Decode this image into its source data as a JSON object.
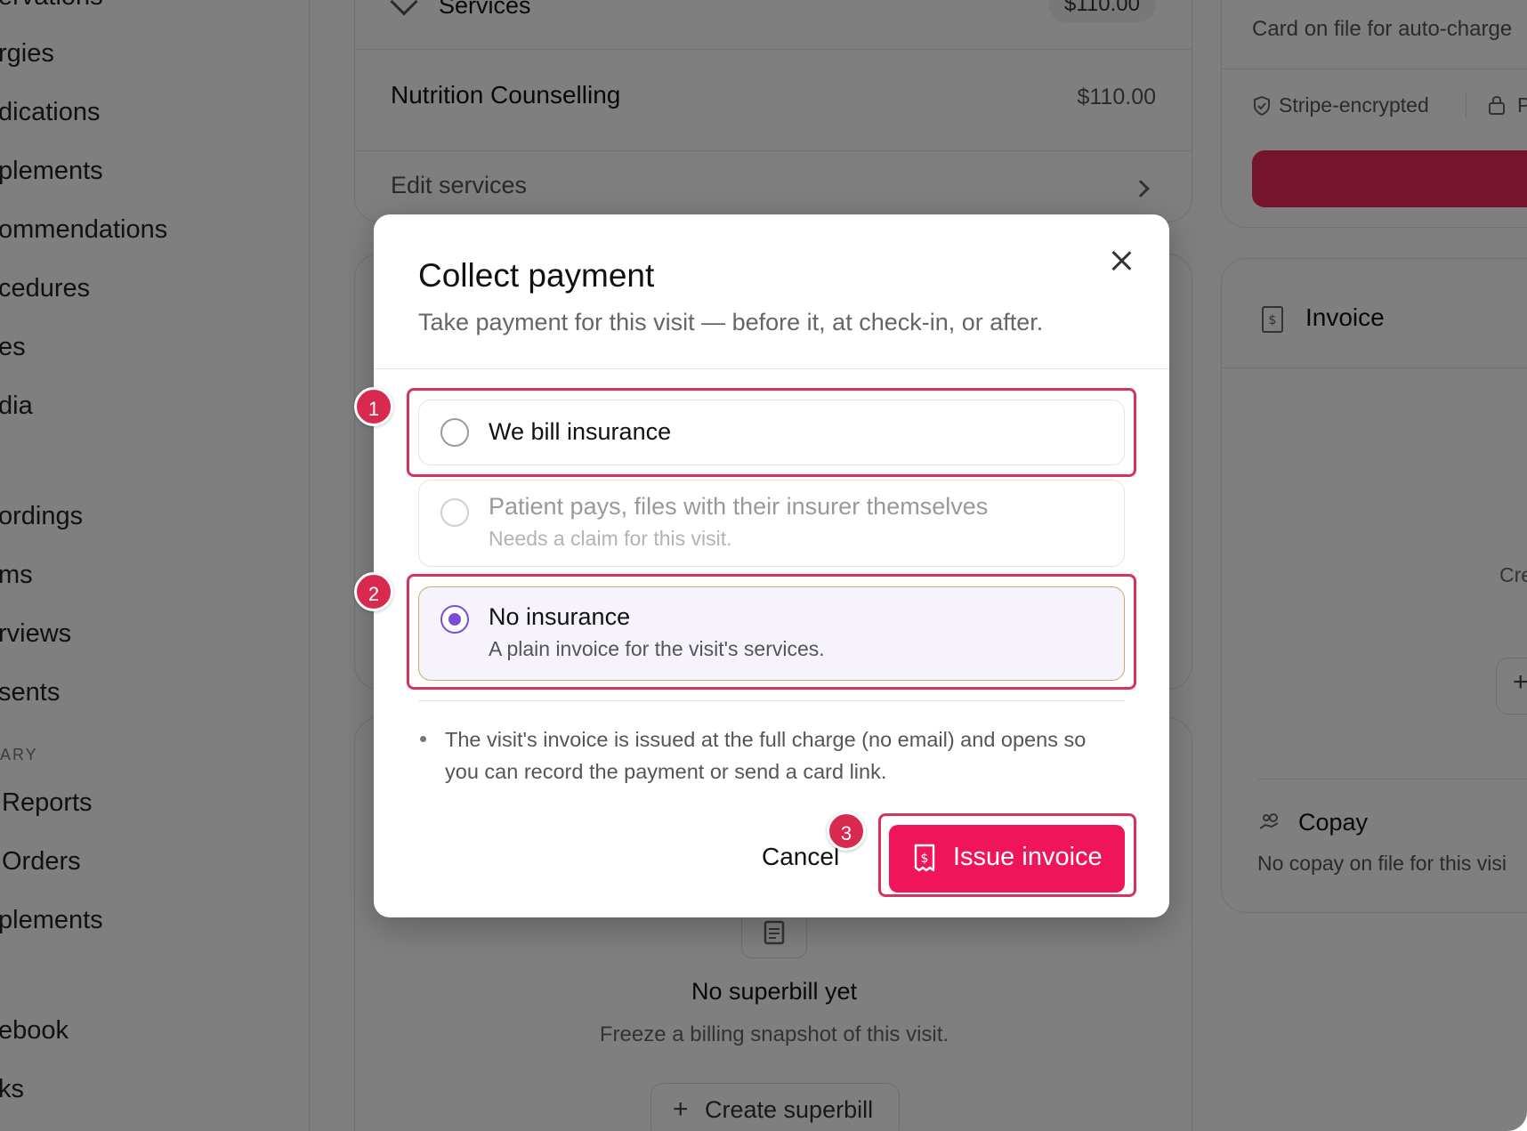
{
  "sidebar": {
    "items": [
      {
        "label": "ervations"
      },
      {
        "label": "rgies"
      },
      {
        "label": "dications"
      },
      {
        "label": "plements"
      },
      {
        "label": "ommendations"
      },
      {
        "label": "cedures"
      },
      {
        "label": "es"
      },
      {
        "label": "dia"
      },
      {
        "label": "ordings"
      },
      {
        "label": "ms"
      },
      {
        "label": "rviews"
      },
      {
        "label": "sents"
      },
      {
        "label": "Reports"
      },
      {
        "label": "Orders"
      },
      {
        "label": "plements"
      },
      {
        "label": "ebook"
      },
      {
        "label": "ks"
      }
    ],
    "section_label": "ARY"
  },
  "services_card": {
    "header": "Services",
    "header_amount": "$110.00",
    "line_item": "Nutrition Counselling",
    "line_amount": "$110.00",
    "edit_link": "Edit services"
  },
  "superbill_card": {
    "empty_title": "No superbill yet",
    "empty_desc": "Freeze a billing snapshot of this visit.",
    "create_button": "Create superbill"
  },
  "right_panel": {
    "card_on_file": "Card on file for auto-charge",
    "stripe_label": "Stripe-encrypted",
    "lock_label": "P",
    "invoice_title": "Invoice",
    "create_partial": "Cre",
    "copay_title": "Copay",
    "copay_desc": "No copay on file for this visi"
  },
  "modal": {
    "title": "Collect payment",
    "subtitle": "Take payment for this visit — before it, at check-in, or after.",
    "options": [
      {
        "label": "We bill insurance",
        "desc": "",
        "selected": false
      },
      {
        "label": "Patient pays, files with their insurer themselves",
        "desc": "Needs a claim for this visit.",
        "selected": false
      },
      {
        "label": "No insurance",
        "desc": "A plain invoice for the visit's services.",
        "selected": true
      }
    ],
    "note": "The visit's invoice is issued at the full charge (no email) and opens so you can record the payment or send a card link.",
    "cancel_label": "Cancel",
    "issue_label": "Issue invoice"
  },
  "steps": [
    "1",
    "2",
    "3"
  ],
  "colors": {
    "accent": "#f0155a",
    "highlight": "#d6335e",
    "radio_selected": "#7c4ddb",
    "selected_bg": "#f7f3fd"
  }
}
